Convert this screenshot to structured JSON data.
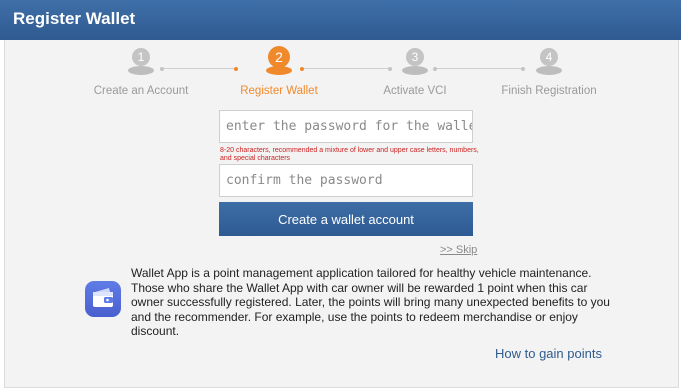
{
  "window": {
    "title": "Register Wallet"
  },
  "steps": [
    {
      "number": "1",
      "label": "Create an Account",
      "state": "completed"
    },
    {
      "number": "2",
      "label": "Register Wallet",
      "state": "active"
    },
    {
      "number": "3",
      "label": "Activate VCI",
      "state": "pending"
    },
    {
      "number": "4",
      "label": "Finish Registration",
      "state": "pending"
    }
  ],
  "form": {
    "password_placeholder": "enter the password for the wallet",
    "password_hint": "8-20 characters, recommended a mixture of lower and upper case letters, numbers, and special characters",
    "confirm_placeholder": "confirm the password",
    "submit_label": "Create a wallet account",
    "skip_label": ">> Skip"
  },
  "info": {
    "icon": "wallet-icon",
    "description": "Wallet App is a point management application tailored for healthy vehicle maintenance. Those who share the Wallet App with car owner will be rewarded 1 point when this car owner successfully registered. Later, the points will bring many unexpected benefits to you and the recommender. For example, use the points to redeem merchandise or enjoy discount.",
    "link_label": "How to gain points"
  },
  "colors": {
    "header": "#2f5a91",
    "active_step": "#f0892c",
    "inactive_step": "#c4c4c4",
    "button": "#3e6ea6",
    "hint_text": "#cc2222",
    "link": "#2f5b8f"
  }
}
